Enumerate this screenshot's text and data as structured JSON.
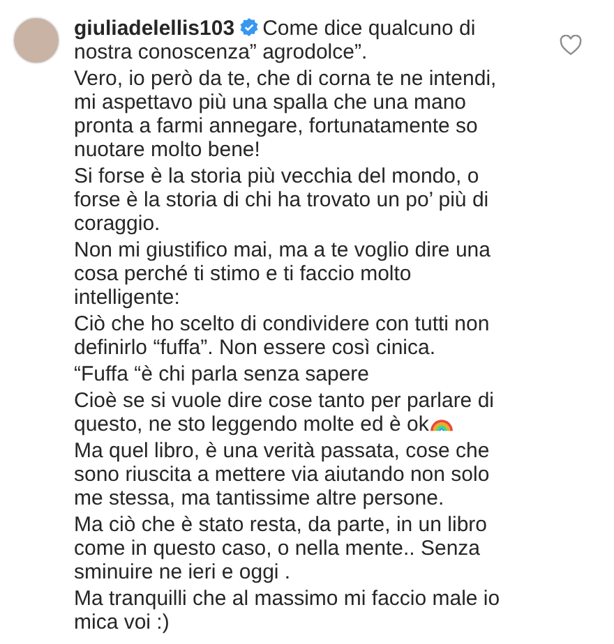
{
  "comment": {
    "username": "giuliadelellis103",
    "verified": true,
    "liked": false,
    "paragraphs": [
      {
        "kind": "plain",
        "text": "Come dice qualcuno di nostra conoscenza” agrodolce”."
      },
      {
        "kind": "plain",
        "text": "Vero, io però da te, che di corna te ne intendi, mi aspettavo più una spalla che una mano pronta a farmi annegare, fortunatamente so nuotare molto bene!"
      },
      {
        "kind": "plain",
        "text": "Si forse è la storia più vecchia del mondo, o forse è la storia di chi ha trovato un po’ più di coraggio."
      },
      {
        "kind": "plain",
        "text": "Non mi giustifico mai, ma a te voglio dire una cosa perché ti stimo e ti faccio molto intelligente:"
      },
      {
        "kind": "plain",
        "text": "Ciò che ho scelto di condividere con tutti non definirlo “fuffa”. Non essere così cinica."
      },
      {
        "kind": "plain",
        "text": "“Fuffa “è chi parla senza sapere"
      },
      {
        "kind": "emoji",
        "text": "Cioè se si vuole dire cose tanto per parlare di questo, ne sto leggendo molte ed è ok"
      },
      {
        "kind": "plain",
        "text": "Ma quel libro, è una verità passata, cose che sono riuscita a mettere via aiutando non solo me stessa, ma tantissime altre persone."
      },
      {
        "kind": "plain",
        "text": "Ma ciò che è stato resta, da parte, in un libro come in questo caso, o nella mente.. Senza sminuire ne ieri e oggi ."
      },
      {
        "kind": "plain",
        "text": "Ma tranquilli che al massimo mi faccio male io mica voi :)"
      }
    ]
  }
}
